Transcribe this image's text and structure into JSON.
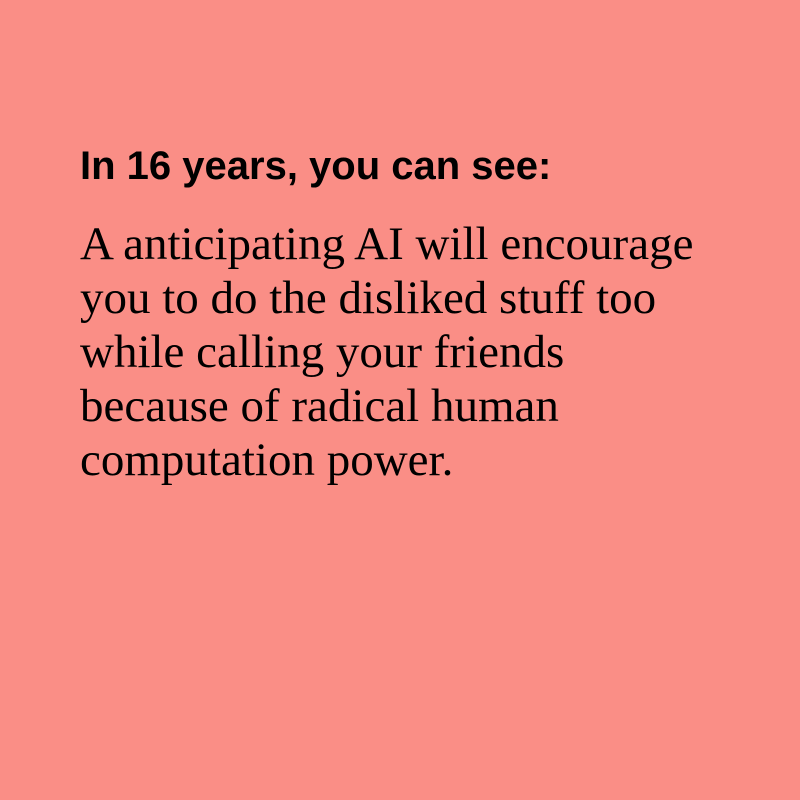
{
  "card": {
    "heading": "In 16 years, you can see:",
    "body": "A anticipating AI will encourage you to do the disliked stuff too while calling your friends because of radical human computation power."
  },
  "colors": {
    "background": "#fa8e86",
    "text": "#000000"
  }
}
